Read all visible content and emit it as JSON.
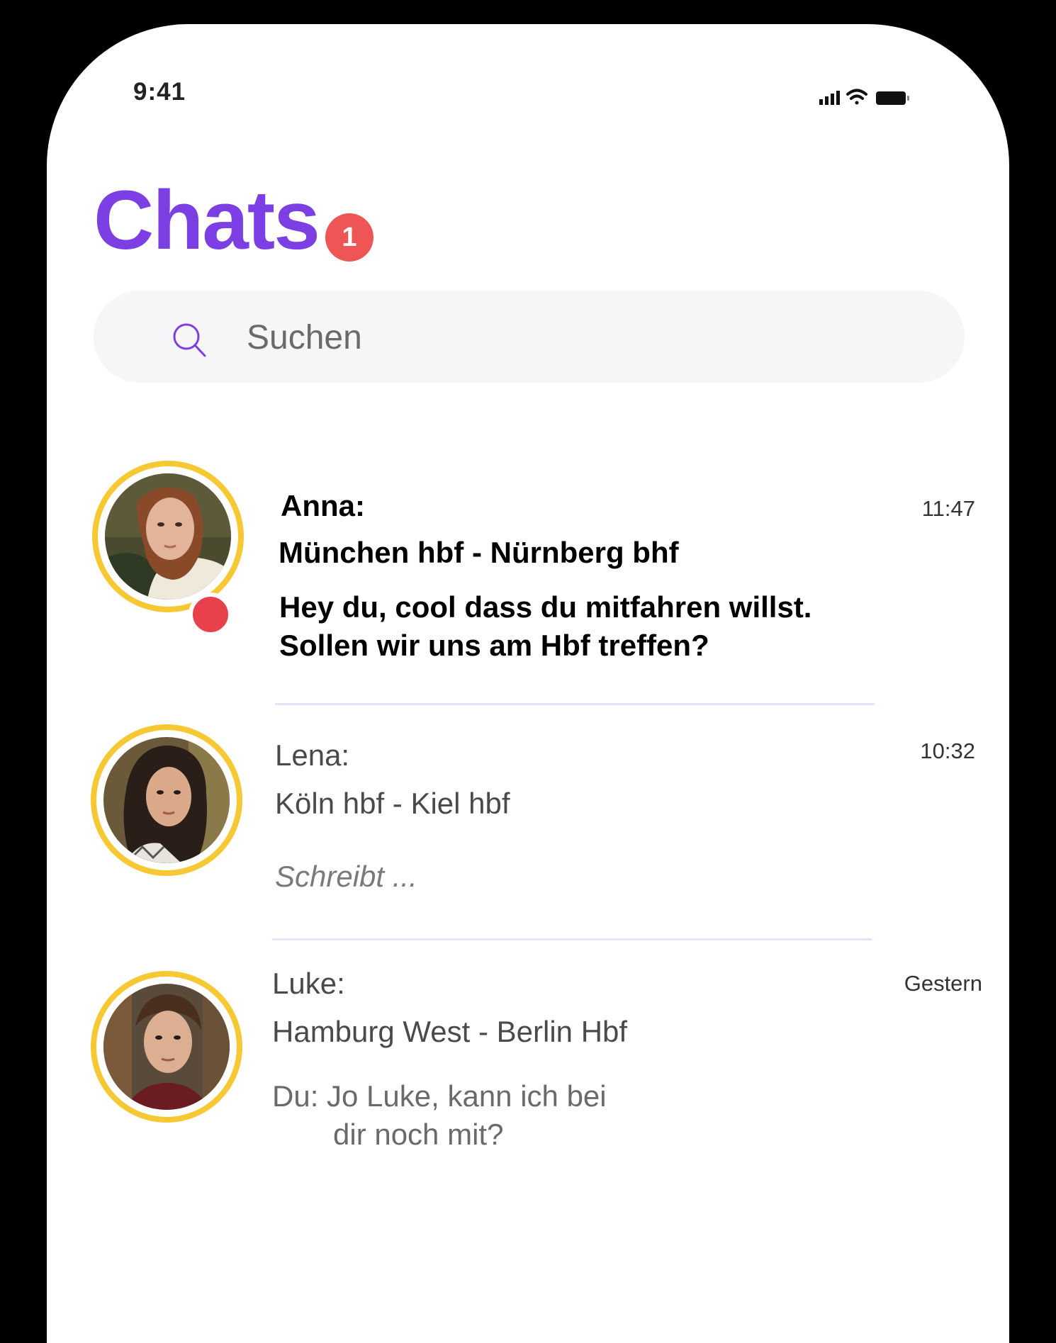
{
  "status_bar": {
    "time": "9:41"
  },
  "header": {
    "title": "Chats",
    "unread_badge": "1"
  },
  "search": {
    "placeholder": "Suchen"
  },
  "colors": {
    "accent": "#7b3fe4",
    "badge": "#ee5555",
    "avatar_ring": "#f6c833",
    "online_dot": "#e8414c"
  },
  "chats": [
    {
      "name": "Anna:",
      "route": "München hbf - Nürnberg bhf",
      "message_line1": "Hey du, cool dass du mitfahren willst.",
      "message_line2": "Sollen wir uns am Hbf treffen?",
      "time": "11:47",
      "unread": true
    },
    {
      "name": "Lena:",
      "route": "Köln hbf - Kiel hbf",
      "message_line1": "Schreibt ...",
      "time": "10:32",
      "typing": true
    },
    {
      "name": "Luke:",
      "route": "Hamburg West - Berlin Hbf",
      "message_line1": "Du: Jo Luke, kann ich bei",
      "message_line2": "dir noch mit?",
      "time": "Gestern"
    }
  ]
}
